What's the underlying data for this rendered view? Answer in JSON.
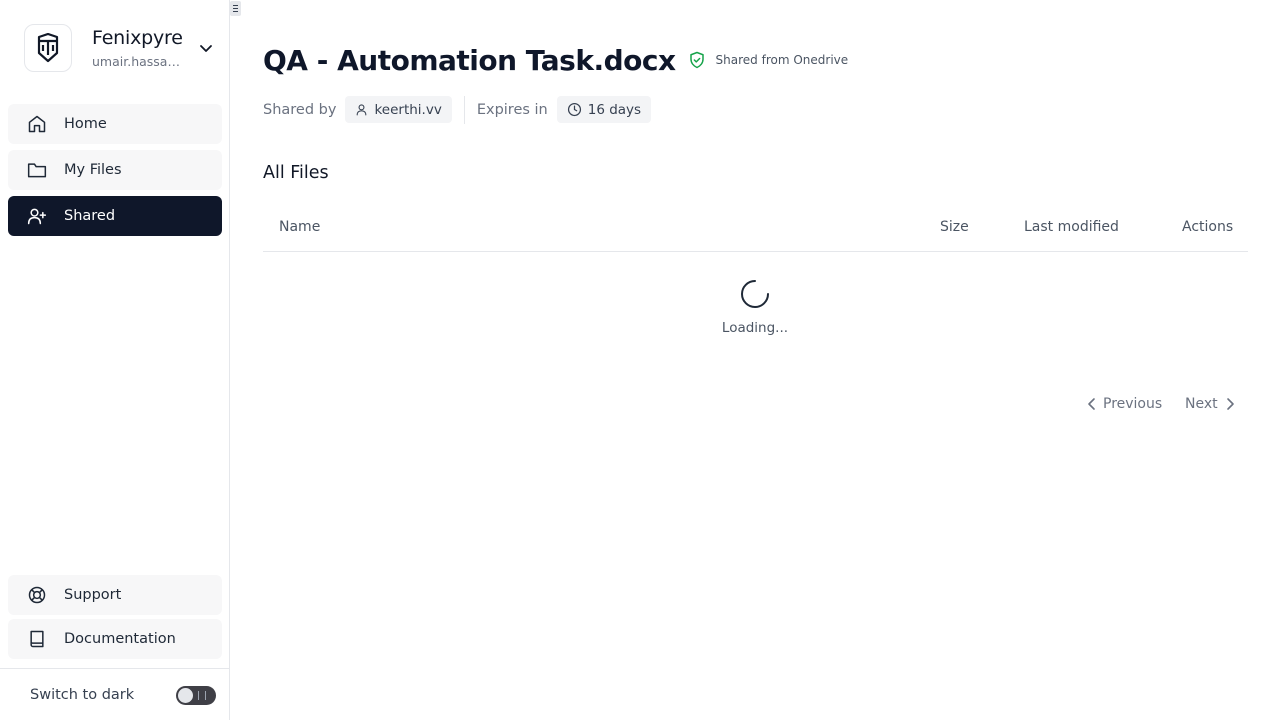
{
  "sidebar": {
    "org": {
      "name": "Fenixpyre",
      "email": "umair.hassan@..."
    },
    "nav": [
      {
        "label": "Home",
        "icon": "home-icon",
        "active": false
      },
      {
        "label": "My Files",
        "icon": "folder-icon",
        "active": false
      },
      {
        "label": "Shared",
        "icon": "user-plus-icon",
        "active": true
      }
    ],
    "bottom_nav": [
      {
        "label": "Support",
        "icon": "life-buoy-icon"
      },
      {
        "label": "Documentation",
        "icon": "book-icon"
      }
    ],
    "theme_toggle": {
      "label": "Switch to dark",
      "on": false
    }
  },
  "file": {
    "title": "QA - Automation Task.docx",
    "source": "Shared from Onedrive",
    "shared_by_label": "Shared by",
    "shared_by": "keerthi.vv",
    "expires_label": "Expires in",
    "expires": "16 days"
  },
  "files_section": {
    "title": "All Files",
    "columns": [
      "Name",
      "Size",
      "Last modified",
      "Actions"
    ],
    "loading_text": "Loading..."
  },
  "pagination": {
    "previous": "Previous",
    "next": "Next"
  },
  "colors": {
    "active_nav": "#0f172a",
    "shield": "#16a34a"
  }
}
